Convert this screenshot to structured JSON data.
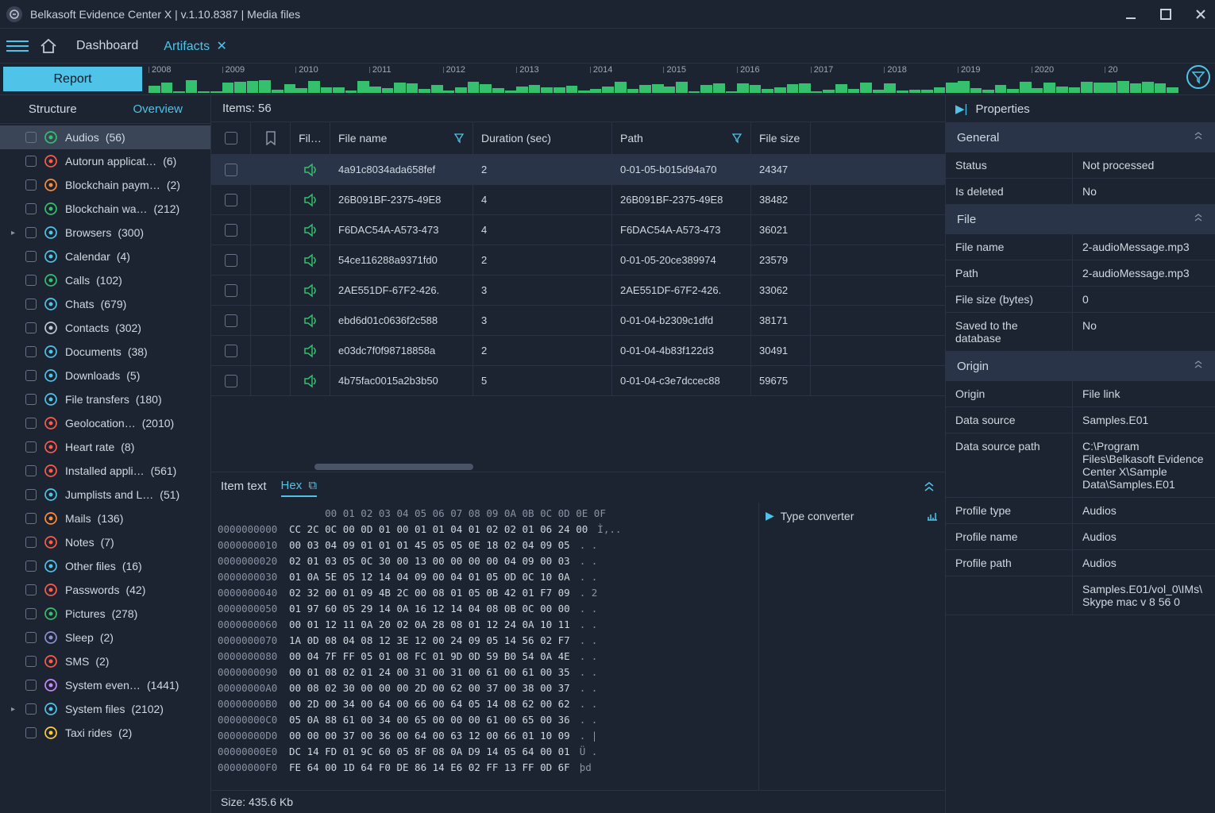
{
  "window_title": "Belkasoft Evidence Center X | v.1.10.8387 | Media files",
  "toolbar": {
    "tab_dashboard": "Dashboard",
    "tab_artifacts": "Artifacts"
  },
  "report_label": "Report",
  "timeline_years": [
    "2008",
    "2009",
    "2010",
    "2011",
    "2012",
    "2013",
    "2014",
    "2015",
    "2016",
    "2017",
    "2018",
    "2019",
    "2020",
    "20"
  ],
  "sidebar": {
    "tab_structure": "Structure",
    "tab_overview": "Overview",
    "items": [
      {
        "label": "Audios",
        "count": "(56)",
        "icon": "audio",
        "color": "#34c06c",
        "selected": true
      },
      {
        "label": "Autorun applicat…",
        "count": "(6)",
        "icon": "app",
        "color": "#ff5a4a"
      },
      {
        "label": "Blockchain paym…",
        "count": "(2)",
        "icon": "btc",
        "color": "#ff8c3a"
      },
      {
        "label": "Blockchain wa…",
        "count": "(212)",
        "icon": "btc2",
        "color": "#34c06c"
      },
      {
        "label": "Browsers",
        "count": "(300)",
        "icon": "globe",
        "color": "#4fc3e8",
        "exp": true
      },
      {
        "label": "Calendar",
        "count": "(4)",
        "icon": "cal",
        "color": "#4fc3e8"
      },
      {
        "label": "Calls",
        "count": "(102)",
        "icon": "phone",
        "color": "#34c06c"
      },
      {
        "label": "Chats",
        "count": "(679)",
        "icon": "chat",
        "color": "#4fc3e8"
      },
      {
        "label": "Contacts",
        "count": "(302)",
        "icon": "contact",
        "color": "#c0c8d8"
      },
      {
        "label": "Documents",
        "count": "(38)",
        "icon": "doc",
        "color": "#4fc3e8"
      },
      {
        "label": "Downloads",
        "count": "(5)",
        "icon": "dl",
        "color": "#4fc3e8"
      },
      {
        "label": "File transfers",
        "count": "(180)",
        "icon": "ft",
        "color": "#4fc3e8"
      },
      {
        "label": "Geolocation…",
        "count": "(2010)",
        "icon": "geo",
        "color": "#ff5a4a"
      },
      {
        "label": "Heart rate",
        "count": "(8)",
        "icon": "heart",
        "color": "#ff5a4a"
      },
      {
        "label": "Installed appli…",
        "count": "(561)",
        "icon": "app2",
        "color": "#ff5a4a"
      },
      {
        "label": "Jumplists and L…",
        "count": "(51)",
        "icon": "link",
        "color": "#4fc3e8"
      },
      {
        "label": "Mails",
        "count": "(136)",
        "icon": "mail",
        "color": "#ff8c3a"
      },
      {
        "label": "Notes",
        "count": "(7)",
        "icon": "note",
        "color": "#ff5a4a"
      },
      {
        "label": "Other files",
        "count": "(16)",
        "icon": "file",
        "color": "#4fc3e8"
      },
      {
        "label": "Passwords",
        "count": "(42)",
        "icon": "key",
        "color": "#ff5a4a"
      },
      {
        "label": "Pictures",
        "count": "(278)",
        "icon": "pic",
        "color": "#34c06c"
      },
      {
        "label": "Sleep",
        "count": "(2)",
        "icon": "sleep",
        "color": "#8a92d4"
      },
      {
        "label": "SMS",
        "count": "(2)",
        "icon": "sms",
        "color": "#ff5a4a"
      },
      {
        "label": "System even…",
        "count": "(1441)",
        "icon": "log",
        "color": "#c88aff"
      },
      {
        "label": "System files",
        "count": "(2102)",
        "icon": "sfiles",
        "color": "#4fc3e8",
        "exp": true
      },
      {
        "label": "Taxi rides",
        "count": "(2)",
        "icon": "taxi",
        "color": "#ffcc3a"
      }
    ]
  },
  "grid": {
    "items_label": "Items: 56",
    "cols": {
      "chk": "",
      "bm": "",
      "type": "Fil…",
      "name": "File name",
      "dur": "Duration (sec)",
      "path": "Path",
      "size": "File size"
    },
    "rows": [
      {
        "name": "4a91c8034ada658fef",
        "dur": "2",
        "path": "0-01-05-b015d94a70",
        "size": "24347",
        "sel": true
      },
      {
        "name": "26B091BF-2375-49E8",
        "dur": "4",
        "path": "26B091BF-2375-49E8",
        "size": "38482"
      },
      {
        "name": "F6DAC54A-A573-473",
        "dur": "4",
        "path": "F6DAC54A-A573-473",
        "size": "36021"
      },
      {
        "name": "54ce116288a9371fd0",
        "dur": "2",
        "path": "0-01-05-20ce389974",
        "size": "23579"
      },
      {
        "name": "2AE551DF-67F2-426.",
        "dur": "3",
        "path": "2AE551DF-67F2-426.",
        "size": "33062"
      },
      {
        "name": "ebd6d01c0636f2c588",
        "dur": "3",
        "path": "0-01-04-b2309c1dfd",
        "size": "38171"
      },
      {
        "name": "e03dc7f0f98718858a",
        "dur": "2",
        "path": "0-01-04-4b83f122d3",
        "size": "30491"
      },
      {
        "name": "4b75fac0015a2b3b50",
        "dur": "5",
        "path": "0-01-04-c3e7dccec88",
        "size": "59675"
      }
    ]
  },
  "bottom": {
    "tab_item": "Item text",
    "tab_hex": "Hex",
    "type_converter": "Type converter",
    "size": "Size: 435.6 Kb",
    "hex_head": "      00 01 02 03 04 05 06 07 08 09 0A 0B 0C 0D 0E 0F",
    "hex_rows": [
      {
        "off": "0000000000",
        "b": "CC 2C 0C 00 0D 01 00 01 01 04 01 02 02 01 06 24 00",
        "a": "Ì,.."
      },
      {
        "off": "0000000010",
        "b": "00 03 04 09 01 01 01 45 05 05 0E 18 02 04 09 05",
        "a": ". ."
      },
      {
        "off": "0000000020",
        "b": "02 01 03 05 0C 30 00 13 00 00 00 00 04 09 00 03",
        "a": ". ."
      },
      {
        "off": "0000000030",
        "b": "01 0A 5E 05 12 14 04 09 00 04 01 05 0D 0C 10 0A",
        "a": ". ."
      },
      {
        "off": "0000000040",
        "b": "02 32 00 01 09 4B 2C 00 08 01 05 0B 42 01 F7 09",
        "a": ". 2"
      },
      {
        "off": "0000000050",
        "b": "01 97 60 05 29 14 0A 16 12 14 04 08 0B 0C 00 00",
        "a": ". ."
      },
      {
        "off": "0000000060",
        "b": "00 01 12 11 0A 20 02 0A 28 08 01 12 24 0A 10 11",
        "a": ". ."
      },
      {
        "off": "0000000070",
        "b": "1A 0D 08 04 08 12 3E 12 00 24 09 05 14 56 02 F7",
        "a": ". ."
      },
      {
        "off": "0000000080",
        "b": "00 04 7F FF 05 01 08 FC 01 9D 0D 59 B0 54 0A 4E",
        "a": ". ."
      },
      {
        "off": "0000000090",
        "b": "00 01 08 02 01 24 00 31 00 31 00 61 00 61 00 35",
        "a": ". ."
      },
      {
        "off": "00000000A0",
        "b": "00 08 02 30 00 00 00 2D 00 62 00 37 00 38 00 37",
        "a": ". ."
      },
      {
        "off": "00000000B0",
        "b": "00 2D 00 34 00 64 00 66 00 64 05 14 08 62 00 62",
        "a": ". ."
      },
      {
        "off": "00000000C0",
        "b": "05 0A 88 61 00 34 00 65 00 00 00 61 00 65 00 36",
        "a": ". ."
      },
      {
        "off": "00000000D0",
        "b": "00 00 00 37 00 36 00 64 00 63 12 00 66 01 10 09",
        "a": ". |"
      },
      {
        "off": "00000000E0",
        "b": "DC 14 FD 01 9C 60 05 8F 08 0A D9 14 05 64 00 01",
        "a": "Ü ."
      },
      {
        "off": "00000000F0",
        "b": "FE 64 00 1D 64 F0 DE 86 14 E6 02 FF 13 FF 0D 6F",
        "a": "þd"
      }
    ]
  },
  "props": {
    "title": "Properties",
    "sections": {
      "general": {
        "title": "General",
        "rows": [
          {
            "k": "Status",
            "v": "Not processed"
          },
          {
            "k": "Is deleted",
            "v": "No"
          }
        ]
      },
      "file": {
        "title": "File",
        "rows": [
          {
            "k": "File name",
            "v": "2-audioMessage.mp3"
          },
          {
            "k": "Path",
            "v": "2-audioMessage.mp3"
          },
          {
            "k": "File size (bytes)",
            "v": "0"
          },
          {
            "k": "Saved to the database",
            "v": "No"
          }
        ]
      },
      "origin": {
        "title": "Origin",
        "rows": [
          {
            "k": "Origin",
            "v": "File link"
          },
          {
            "k": "Data source",
            "v": "Samples.E01"
          },
          {
            "k": "Data source path",
            "v": "C:\\Program Files\\Belkasoft Evidence Center X\\Sample Data\\Samples.E01"
          },
          {
            "k": "Profile type",
            "v": "Audios"
          },
          {
            "k": "Profile name",
            "v": "Audios"
          },
          {
            "k": "Profile path",
            "v": "Audios"
          },
          {
            "k": "",
            "v": "Samples.E01/vol_0\\IMs\\Skype mac v 8 56 0"
          }
        ]
      }
    }
  }
}
